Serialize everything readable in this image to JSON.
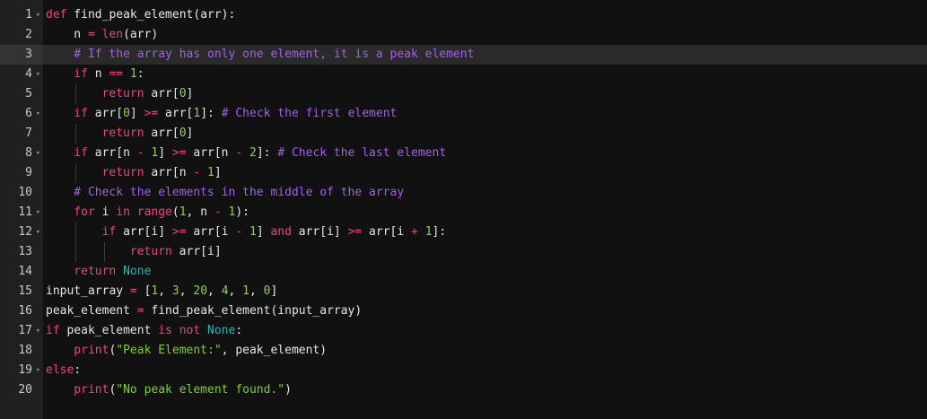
{
  "editor": {
    "active_line": 3,
    "lines": [
      {
        "n": "1",
        "fold": true,
        "indent": 0,
        "tokens": [
          {
            "t": "def",
            "c": "kw"
          },
          {
            "t": " find_peak_element(arr):",
            "c": "plain"
          }
        ]
      },
      {
        "n": "2",
        "fold": false,
        "indent": 1,
        "tokens": [
          {
            "t": "n ",
            "c": "plain"
          },
          {
            "t": "=",
            "c": "op"
          },
          {
            "t": " ",
            "c": "plain"
          },
          {
            "t": "len",
            "c": "bi"
          },
          {
            "t": "(arr)",
            "c": "plain"
          }
        ]
      },
      {
        "n": "3",
        "fold": false,
        "indent": 1,
        "tokens": [
          {
            "t": "# If the array has only one element, it is a peak element",
            "c": "cm"
          }
        ]
      },
      {
        "n": "4",
        "fold": true,
        "indent": 1,
        "tokens": [
          {
            "t": "if",
            "c": "kw"
          },
          {
            "t": " n ",
            "c": "plain"
          },
          {
            "t": "==",
            "c": "op"
          },
          {
            "t": " ",
            "c": "plain"
          },
          {
            "t": "1",
            "c": "num"
          },
          {
            "t": ":",
            "c": "plain"
          }
        ]
      },
      {
        "n": "5",
        "fold": false,
        "indent": 2,
        "tokens": [
          {
            "t": "return",
            "c": "kw"
          },
          {
            "t": " arr[",
            "c": "plain"
          },
          {
            "t": "0",
            "c": "num"
          },
          {
            "t": "]",
            "c": "plain"
          }
        ]
      },
      {
        "n": "6",
        "fold": true,
        "indent": 1,
        "tokens": [
          {
            "t": "if",
            "c": "kw"
          },
          {
            "t": " arr[",
            "c": "plain"
          },
          {
            "t": "0",
            "c": "num"
          },
          {
            "t": "] ",
            "c": "plain"
          },
          {
            "t": ">=",
            "c": "op"
          },
          {
            "t": " arr[",
            "c": "plain"
          },
          {
            "t": "1",
            "c": "num"
          },
          {
            "t": "]: ",
            "c": "plain"
          },
          {
            "t": "# Check the first element",
            "c": "cm"
          }
        ]
      },
      {
        "n": "7",
        "fold": false,
        "indent": 2,
        "tokens": [
          {
            "t": "return",
            "c": "kw"
          },
          {
            "t": " arr[",
            "c": "plain"
          },
          {
            "t": "0",
            "c": "num"
          },
          {
            "t": "]",
            "c": "plain"
          }
        ]
      },
      {
        "n": "8",
        "fold": true,
        "indent": 1,
        "tokens": [
          {
            "t": "if",
            "c": "kw"
          },
          {
            "t": " arr[n ",
            "c": "plain"
          },
          {
            "t": "-",
            "c": "op"
          },
          {
            "t": " ",
            "c": "plain"
          },
          {
            "t": "1",
            "c": "num"
          },
          {
            "t": "] ",
            "c": "plain"
          },
          {
            "t": ">=",
            "c": "op"
          },
          {
            "t": " arr[n ",
            "c": "plain"
          },
          {
            "t": "-",
            "c": "op"
          },
          {
            "t": " ",
            "c": "plain"
          },
          {
            "t": "2",
            "c": "num"
          },
          {
            "t": "]: ",
            "c": "plain"
          },
          {
            "t": "# Check the last element",
            "c": "cm"
          }
        ]
      },
      {
        "n": "9",
        "fold": false,
        "indent": 2,
        "tokens": [
          {
            "t": "return",
            "c": "kw"
          },
          {
            "t": " arr[n ",
            "c": "plain"
          },
          {
            "t": "-",
            "c": "op"
          },
          {
            "t": " ",
            "c": "plain"
          },
          {
            "t": "1",
            "c": "num"
          },
          {
            "t": "]",
            "c": "plain"
          }
        ]
      },
      {
        "n": "10",
        "fold": false,
        "indent": 1,
        "tokens": [
          {
            "t": "# Check the elements in the middle of the array",
            "c": "cm"
          }
        ]
      },
      {
        "n": "11",
        "fold": true,
        "indent": 1,
        "tokens": [
          {
            "t": "for",
            "c": "kw"
          },
          {
            "t": " i ",
            "c": "plain"
          },
          {
            "t": "in",
            "c": "kw"
          },
          {
            "t": " ",
            "c": "plain"
          },
          {
            "t": "range",
            "c": "bi"
          },
          {
            "t": "(",
            "c": "plain"
          },
          {
            "t": "1",
            "c": "num"
          },
          {
            "t": ", n ",
            "c": "plain"
          },
          {
            "t": "-",
            "c": "op"
          },
          {
            "t": " ",
            "c": "plain"
          },
          {
            "t": "1",
            "c": "num"
          },
          {
            "t": "):",
            "c": "plain"
          }
        ]
      },
      {
        "n": "12",
        "fold": true,
        "indent": 2,
        "tokens": [
          {
            "t": "if",
            "c": "kw"
          },
          {
            "t": " arr[i] ",
            "c": "plain"
          },
          {
            "t": ">=",
            "c": "op"
          },
          {
            "t": " arr[i ",
            "c": "plain"
          },
          {
            "t": "-",
            "c": "op"
          },
          {
            "t": " ",
            "c": "plain"
          },
          {
            "t": "1",
            "c": "num"
          },
          {
            "t": "] ",
            "c": "plain"
          },
          {
            "t": "and",
            "c": "kw"
          },
          {
            "t": " arr[i] ",
            "c": "plain"
          },
          {
            "t": ">=",
            "c": "op"
          },
          {
            "t": " arr[i ",
            "c": "plain"
          },
          {
            "t": "+",
            "c": "op"
          },
          {
            "t": " ",
            "c": "plain"
          },
          {
            "t": "1",
            "c": "num"
          },
          {
            "t": "]:",
            "c": "plain"
          }
        ]
      },
      {
        "n": "13",
        "fold": false,
        "indent": 3,
        "tokens": [
          {
            "t": "return",
            "c": "kw"
          },
          {
            "t": " arr[i]",
            "c": "plain"
          }
        ]
      },
      {
        "n": "14",
        "fold": false,
        "indent": 1,
        "tokens": [
          {
            "t": "return",
            "c": "kw"
          },
          {
            "t": " ",
            "c": "plain"
          },
          {
            "t": "None",
            "c": "none"
          }
        ]
      },
      {
        "n": "15",
        "fold": false,
        "indent": 0,
        "tokens": [
          {
            "t": "input_array ",
            "c": "plain"
          },
          {
            "t": "=",
            "c": "op"
          },
          {
            "t": " [",
            "c": "plain"
          },
          {
            "t": "1",
            "c": "num"
          },
          {
            "t": ", ",
            "c": "plain"
          },
          {
            "t": "3",
            "c": "num"
          },
          {
            "t": ", ",
            "c": "plain"
          },
          {
            "t": "20",
            "c": "num"
          },
          {
            "t": ", ",
            "c": "plain"
          },
          {
            "t": "4",
            "c": "num"
          },
          {
            "t": ", ",
            "c": "plain"
          },
          {
            "t": "1",
            "c": "num"
          },
          {
            "t": ", ",
            "c": "plain"
          },
          {
            "t": "0",
            "c": "num"
          },
          {
            "t": "]",
            "c": "plain"
          }
        ]
      },
      {
        "n": "16",
        "fold": false,
        "indent": 0,
        "tokens": [
          {
            "t": "peak_element ",
            "c": "plain"
          },
          {
            "t": "=",
            "c": "op"
          },
          {
            "t": " find_peak_element(input_array)",
            "c": "plain"
          }
        ]
      },
      {
        "n": "17",
        "fold": true,
        "indent": 0,
        "tokens": [
          {
            "t": "if",
            "c": "kw"
          },
          {
            "t": " peak_element ",
            "c": "plain"
          },
          {
            "t": "is",
            "c": "kw"
          },
          {
            "t": " ",
            "c": "plain"
          },
          {
            "t": "not",
            "c": "kw"
          },
          {
            "t": " ",
            "c": "plain"
          },
          {
            "t": "None",
            "c": "none"
          },
          {
            "t": ":",
            "c": "plain"
          }
        ]
      },
      {
        "n": "18",
        "fold": false,
        "indent": 1,
        "tokens": [
          {
            "t": "print",
            "c": "bi"
          },
          {
            "t": "(",
            "c": "plain"
          },
          {
            "t": "\"Peak Element:\"",
            "c": "str"
          },
          {
            "t": ", peak_element)",
            "c": "plain"
          }
        ]
      },
      {
        "n": "19",
        "fold": true,
        "indent": 0,
        "tokens": [
          {
            "t": "else",
            "c": "kw"
          },
          {
            "t": ":",
            "c": "plain"
          }
        ]
      },
      {
        "n": "20",
        "fold": false,
        "indent": 1,
        "tokens": [
          {
            "t": "print",
            "c": "bi"
          },
          {
            "t": "(",
            "c": "plain"
          },
          {
            "t": "\"No peak element found.\"",
            "c": "str"
          },
          {
            "t": ")",
            "c": "plain"
          }
        ]
      }
    ]
  }
}
